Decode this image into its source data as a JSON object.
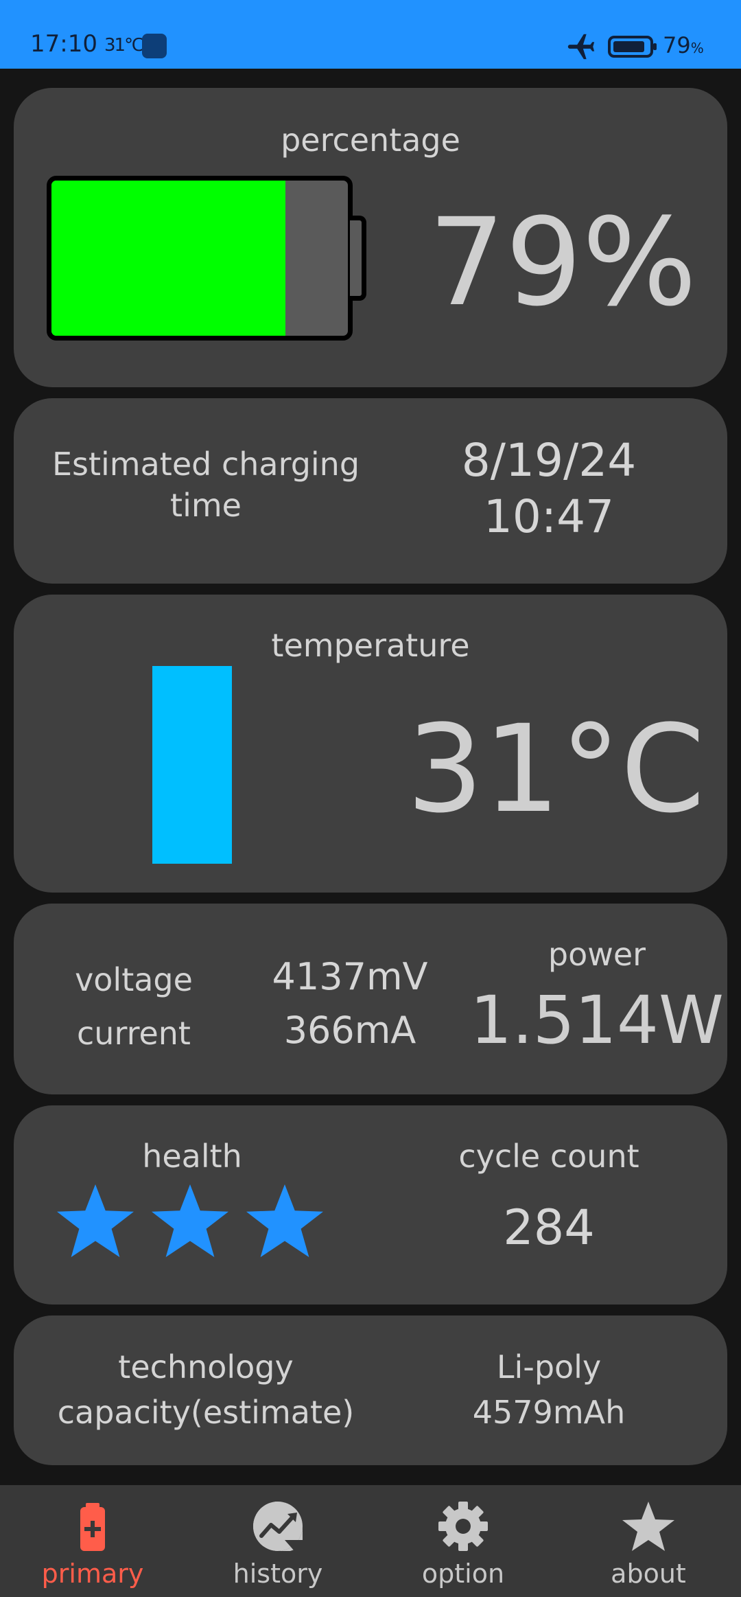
{
  "status_bar": {
    "time": "17:10",
    "temp": "31℃",
    "battery_percent": "79",
    "battery_percent_suffix": "%"
  },
  "percentage_card": {
    "title": "percentage",
    "value": "79%",
    "fill_fraction": 0.79,
    "fill_color": "#00ff00"
  },
  "charging_card": {
    "label_line1": "Estimated charging",
    "label_line2": "time",
    "date": "8/19/24",
    "time": "10:47"
  },
  "temperature_card": {
    "title": "temperature",
    "value": "31°C",
    "bar_color": "#00bfff",
    "bar_fill_fraction": 1.0
  },
  "electrical_card": {
    "voltage_label": "voltage",
    "current_label": "current",
    "voltage_value": "4137mV",
    "current_value": "366mA",
    "power_label": "power",
    "power_value": "1.514W"
  },
  "health_card": {
    "health_label": "health",
    "stars_rating": 3,
    "stars_max": 3,
    "star_color": "#2192ff",
    "cycle_label": "cycle count",
    "cycle_value": "284"
  },
  "tech_card": {
    "technology_label": "technology",
    "capacity_label": "capacity(estimate)",
    "technology_value": "Li-poly",
    "capacity_value": "4579mAh"
  },
  "nav": {
    "items": [
      {
        "label": "primary",
        "icon": "battery-plus-icon",
        "active": true
      },
      {
        "label": "history",
        "icon": "history-chart-icon",
        "active": false
      },
      {
        "label": "option",
        "icon": "gear-icon",
        "active": false
      },
      {
        "label": "about",
        "icon": "star-icon",
        "active": false
      }
    ],
    "active_color": "#ff5d4a"
  }
}
